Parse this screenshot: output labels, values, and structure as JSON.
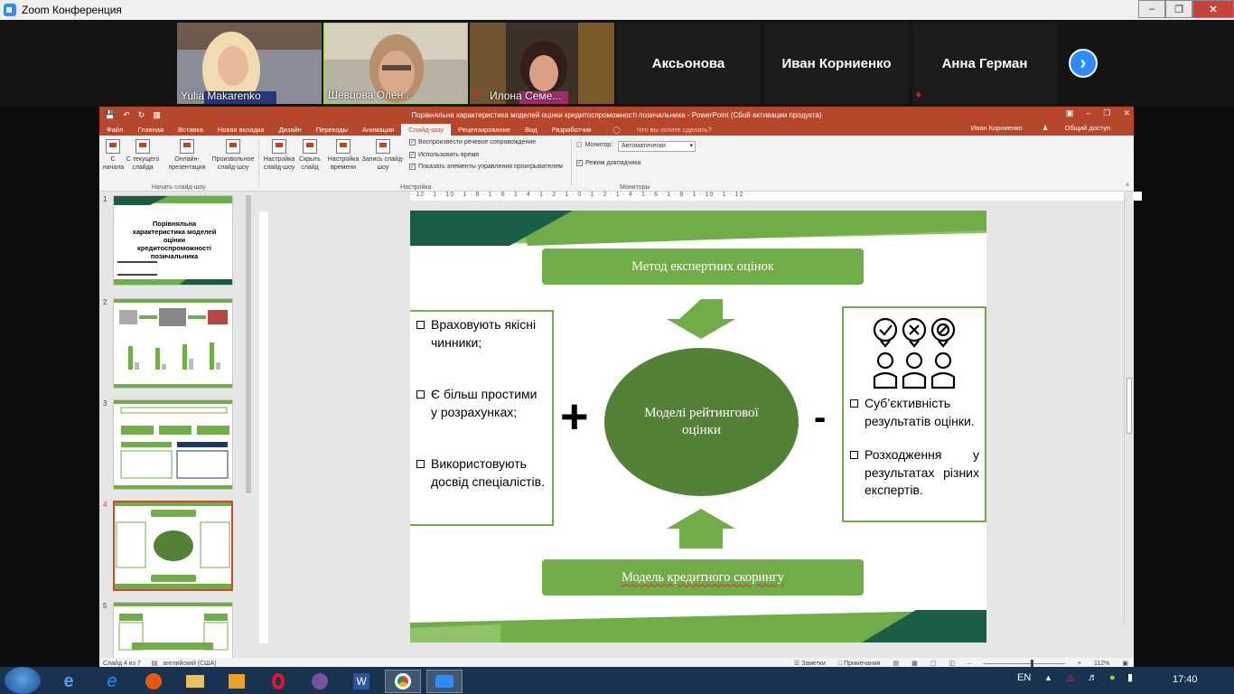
{
  "zoom": {
    "window_title": "Zoom Конференция",
    "participants_video": [
      {
        "name": "Yulia Makarenko"
      },
      {
        "name": "Шевцова Олен..."
      },
      {
        "name": "Илона Семе..."
      }
    ],
    "participants_tiles": [
      {
        "name": "Аксьонова"
      },
      {
        "name": "Иван Корниенко"
      },
      {
        "name": "Анна Герман"
      }
    ]
  },
  "ppt": {
    "title": "Порівняльна характеристика моделей оцінки кредитоспроможності позичальника - PowerPoint (Сбой активации продукта)",
    "tabs": [
      "Файл",
      "Главная",
      "Вставка",
      "Новая вкладка",
      "Дизайн",
      "Переходы",
      "Анимация",
      "Слайд-шоу",
      "Рецензирование",
      "Вид",
      "Разработчик"
    ],
    "active_tab": "Слайд-шоу",
    "tell_me": "Что вы хотите сделать?",
    "user": "Иван Корниенко",
    "share": "Общий доступ",
    "ribbon": {
      "btn_from_start": "С начала",
      "btn_from_current": "С текущего слайда",
      "btn_online": "Онлайн-презентация",
      "btn_custom": "Произвольное слайд-шоу",
      "group_start": "Начать слайд-шоу",
      "btn_setup": "Настройка слайд-шоу",
      "btn_hide": "Скрыть слайд",
      "btn_rehearse": "Настройка времени",
      "btn_record": "Запись слайд-шоу",
      "chk_narration": "Воспроизвести речевое сопровождение",
      "chk_timings": "Использовать время",
      "chk_controls": "Показать элементы управления проигрывателем",
      "group_setup": "Настройка",
      "monitor_label": "Монитор:",
      "monitor_value": "Автоматически",
      "chk_presenter": "Режим докладчика",
      "group_monitors": "Мониторы"
    },
    "ruler": "· 12 · 1 · 10 · 1 · 8 · 1 · 6 · 1 · 4 · 1 · 2 · 1 · 0 · 1 · 2 · 1 · 4 · 1 · 6 · 1 · 8 · 1 · 10 · 1 · 12 ·",
    "thumbnails": [
      {
        "num": "1",
        "title": "Порівняльна характеристика моделей оцінки кредитоспроможності позичальника"
      },
      {
        "num": "2"
      },
      {
        "num": "3"
      },
      {
        "num": "4"
      },
      {
        "num": "5"
      }
    ],
    "status": {
      "slide": "Слайд 4 из 7",
      "lang": "английский (США)",
      "notes": "Заметки",
      "comments": "Примечания",
      "zoom": "112%"
    }
  },
  "slide": {
    "top_box": "Метод експертних оцінок",
    "bottom_box": "Модель кредитного скорингу",
    "center": "Моделі рейтингової оцінки",
    "plus_sign": "+",
    "minus_sign": "-",
    "left_items": [
      "Враховують якісні чинники;",
      "Є більш простими у розрахунках;",
      "Використовують досвід спеціалістів."
    ],
    "right_items": [
      "Суб’єктивність результатів оцінки.",
      "Розходження у результатах різних експертів."
    ]
  },
  "taskbar": {
    "lang": "EN",
    "time": "17:40"
  },
  "colors": {
    "ppt_accent": "#b7472a",
    "green": "#70ad47",
    "dark_green": "#538135",
    "zoom_blue": "#2d8cff"
  }
}
